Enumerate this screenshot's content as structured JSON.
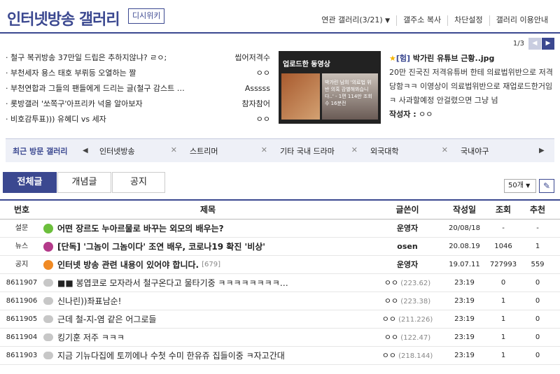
{
  "header": {
    "title": "인터넷방송 갤러리",
    "wiki_label": "디시위키",
    "nav": [
      "연관 갤러리(3/21)",
      "갤주소 복사",
      "차단설정",
      "갤러리 이용안내"
    ]
  },
  "hot": {
    "pager": "1/3",
    "items": [
      {
        "title": "철구 복귀방송 37만일 드립은 추하지않냐? ㄹㅇ;",
        "author": "씹어저격수"
      },
      {
        "title": "부천세자 용스 태호 부뤼등 오열하는 짤",
        "author": "ㅇㅇ"
      },
      {
        "title": "부천연합과 그들의 팬들에게 드리는 글(철구 감스트 …",
        "author": "Asssss"
      },
      {
        "title": "롯방갤러 '쏘쪽구'아프리카 넉을 알아보자",
        "author": "참자참어"
      },
      {
        "title": "비호감투표))) 유혜디 vs 세자",
        "author": "ㅇㅇ"
      }
    ],
    "thumb_label": "업로드한 동영상",
    "thumb_caption": "박가린 님의 '의료법 위반 의혹 감별해봐습니다..' - 1편 114만 조회수 16분전",
    "featured": {
      "tag": "[험]",
      "title": "박가린 유튜브 근황..jpg",
      "desc": "20만 진국진 저격유튜버 한테 의료법위반으로 저격당함ㅋㅋ 이영상이 의료법위반으로 재업로드한거임ㅋ 사과할예정 안걸렸으면 그냥 넘",
      "author_label": "작성자 :",
      "author": "ㅇㅇ"
    }
  },
  "recent": {
    "label": "최근 방문 갤러리",
    "tabs": [
      "인터넷방송",
      "스트리머",
      "기타 국내 드라마",
      "외국대학",
      "국내야구"
    ]
  },
  "tabs": [
    "전체글",
    "개념글",
    "공지"
  ],
  "list_size": "50개",
  "table": {
    "headers": {
      "num": "번호",
      "subject": "제목",
      "writer": "글쓴이",
      "date": "작성일",
      "views": "조회",
      "recommend": "추천"
    },
    "rows": [
      {
        "num": "설문",
        "icon": "g",
        "subject": "어떤 장르도 누아르물로 바꾸는 외모의 배우는?",
        "comments": "",
        "writer": "운영자",
        "ip": "",
        "date": "20/08/18",
        "views": "-",
        "rec": "-",
        "bold": true
      },
      {
        "num": "뉴스",
        "icon": "m",
        "subject": "[단독] '그놈이 그놈이다' 조연 배우, 코로나19 확진 '비상'",
        "comments": "",
        "writer": "osen",
        "ip": "",
        "date": "20.08.19",
        "views": "1046",
        "rec": "1",
        "bold": true
      },
      {
        "num": "공지",
        "icon": "o",
        "subject": "인터넷 방송 관련 내용이 있어야 합니다.",
        "comments": "[679]",
        "writer": "운영자",
        "ip": "",
        "date": "19.07.11",
        "views": "727993",
        "rec": "559",
        "bold": true
      },
      {
        "num": "8611907",
        "icon": "b",
        "subject": "■■ 봉엽코로 모자라서 철구온다고 물타기중 ㅋㅋㅋㅋㅋㅋㅋㅋ…",
        "comments": "",
        "writer": "ㅇㅇ",
        "ip": "(223.62)",
        "date": "23:19",
        "views": "0",
        "rec": "0",
        "bold": false
      },
      {
        "num": "8611906",
        "icon": "b",
        "subject": "신나린))좌표남순!",
        "comments": "",
        "writer": "ㅇㅇ",
        "ip": "(223.38)",
        "date": "23:19",
        "views": "1",
        "rec": "0",
        "bold": false
      },
      {
        "num": "8611905",
        "icon": "b",
        "subject": "근데 철-지-염 같은 어그로들",
        "comments": "",
        "writer": "ㅇㅇ",
        "ip": "(211.226)",
        "date": "23:19",
        "views": "1",
        "rec": "0",
        "bold": false
      },
      {
        "num": "8611904",
        "icon": "b",
        "subject": "킹기훈 저주 ㅋㅋㅋ",
        "comments": "",
        "writer": "ㅇㅇ",
        "ip": "(122.47)",
        "date": "23:19",
        "views": "1",
        "rec": "0",
        "bold": false
      },
      {
        "num": "8611903",
        "icon": "b",
        "subject": "지금 기뉴다집에 토끼에나 수첫 수미 한유쥬 집들이중 ㅋ자고간대",
        "comments": "",
        "writer": "ㅇㅇ",
        "ip": "(218.144)",
        "date": "23:19",
        "views": "1",
        "rec": "0",
        "bold": false
      }
    ]
  },
  "colors": {
    "accent": "#3b4890"
  }
}
